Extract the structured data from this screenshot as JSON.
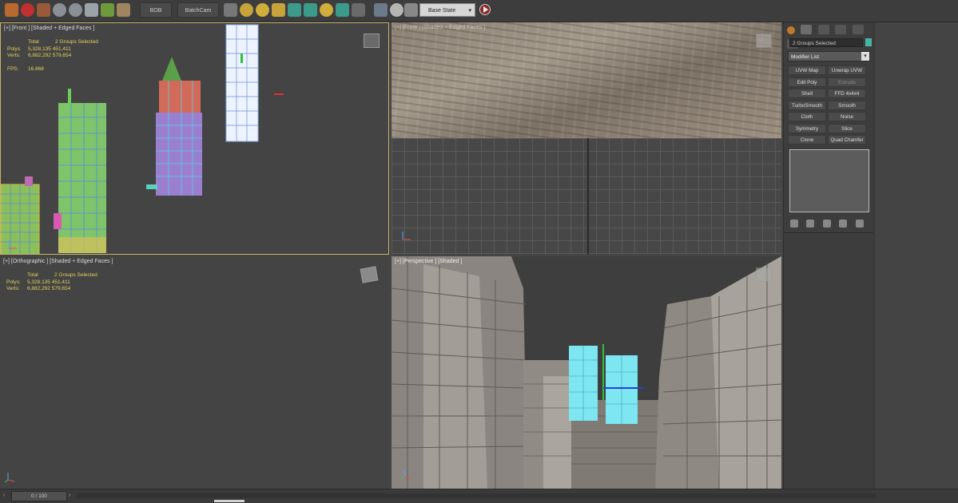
{
  "toolbar": {
    "buttons": [
      "BOB",
      "BatchCam"
    ],
    "state_select": "Base State"
  },
  "viewports": {
    "front": {
      "label": "[+] [Front ] [Shaded + Edged Faces ]",
      "stats": {
        "total_label": "Total",
        "selection": "2 Groups Selected",
        "polys_label": "Polys:",
        "polys_total": "5,328,135",
        "polys_sel": "451,411",
        "verts_label": "Verts:",
        "verts_total": "6,882,292",
        "verts_sel": "579,654",
        "fps_label": "FPS:",
        "fps_value": "16.868"
      }
    },
    "top_right": {
      "label": "[+] [Front ] [Shaded + Edged Faces ]"
    },
    "orthographic": {
      "label": "[+] [Orthographic ] [Shaded + Edged Faces ]",
      "stats": {
        "total_label": "Total",
        "selection": "2 Groups Selected",
        "polys_label": "Polys:",
        "polys_total": "5,328,135",
        "polys_sel": "451,411",
        "verts_label": "Verts:",
        "verts_total": "6,882,292",
        "verts_sel": "579,654"
      }
    },
    "perspective": {
      "label": "[+] [Perspective ] [Shaded ]"
    }
  },
  "command_panel": {
    "object_name": "2 Groups Selected",
    "modifier_list": "Modifier List",
    "modifiers": [
      {
        "label": "UVW Map",
        "dim": false
      },
      {
        "label": "Unwrap UVW",
        "dim": false
      },
      {
        "label": "Edit Poly",
        "dim": false
      },
      {
        "label": "Extrude",
        "dim": true
      },
      {
        "label": "Shell",
        "dim": false
      },
      {
        "label": "FFD 4x4x4",
        "dim": false
      },
      {
        "label": "TurboSmooth",
        "dim": false
      },
      {
        "label": "Smooth",
        "dim": false
      },
      {
        "label": "Cloth",
        "dim": false
      },
      {
        "label": "Noise",
        "dim": false
      },
      {
        "label": "Symmetry",
        "dim": false
      },
      {
        "label": "Slice",
        "dim": false
      },
      {
        "label": "Clone",
        "dim": false
      },
      {
        "label": "Quad Chamfer",
        "dim": false
      }
    ],
    "swatch_color": "#45b6a4"
  },
  "timeline": {
    "frame": "0 / 100"
  },
  "colors": {
    "active_viewport_border": "#c7b26a",
    "stats_text": "#e4d15c",
    "selection_cyan": "#52e0ee"
  }
}
